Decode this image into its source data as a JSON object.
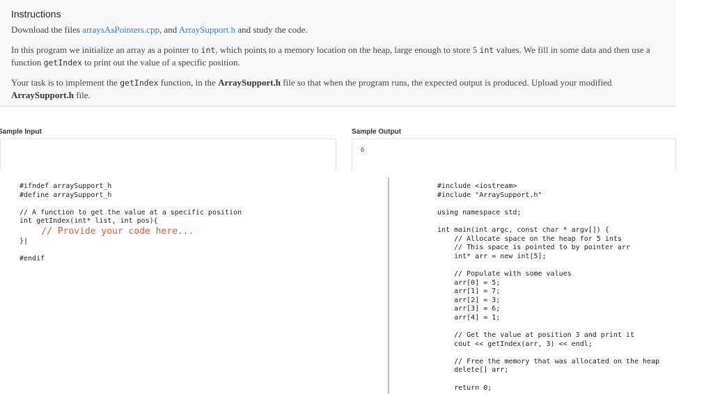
{
  "instructions": {
    "title": "Instructions",
    "p1_a": "Download the files ",
    "p1_link1": "arraysAsPointers.cpp",
    "p1_b": ", and ",
    "p1_link2": "ArraySupport.h",
    "p1_c": " and study the code.",
    "p2_a": "In this program we initialize an array as a pointer to ",
    "p2_code1": "int",
    "p2_b": ", which points to a memory location on the heap, large enough to store 5 ",
    "p2_code2": "int",
    "p2_c": " values. We fill in some data and then use a function ",
    "p2_code3": "getIndex",
    "p2_d": " to print out the value of a specific position.",
    "p3_a": "Your task is to implement the ",
    "p3_code1": "getIndex",
    "p3_b": " function, in the ",
    "p3_bold1": "ArraySupport.h",
    "p3_c": " file so that when the program runs, the expected output is produced. Upload your modified ",
    "p3_bold2": "ArraySupport.h",
    "p3_d": " file."
  },
  "sample_input": {
    "label": "Sample Input",
    "value": ""
  },
  "sample_output": {
    "label": "Sample Output",
    "value": "6"
  },
  "header_code": {
    "part1": "#ifndef arraySupport_h\n#define arraySupport_h\n\n// A function to get the value at a specific position\nint getIndex(int* list, int pos){",
    "placeholder": "    // Provide your code here...",
    "part2": "\n}|\n\n#endif"
  },
  "main_code": "#include <iostream>\n#include \"ArraySupport.h\"\n\nusing namespace std;\n\nint main(int argc, const char * argv[]) {\n    // Allocate space on the heap for 5 ints\n    // This space is pointed to by pointer arr\n    int* arr = new int[5];\n\n    // Populate with some values\n    arr[0] = 5;\n    arr[1] = 7;\n    arr[2] = 3;\n    arr[3] = 6;\n    arr[4] = 1;\n\n    // Get the value at position 3 and print it\n    cout << getIndex(arr, 3) << endl;\n\n    // Free the memory that was allocated on the heap\n    delete[] arr;\n\n    return 0;"
}
